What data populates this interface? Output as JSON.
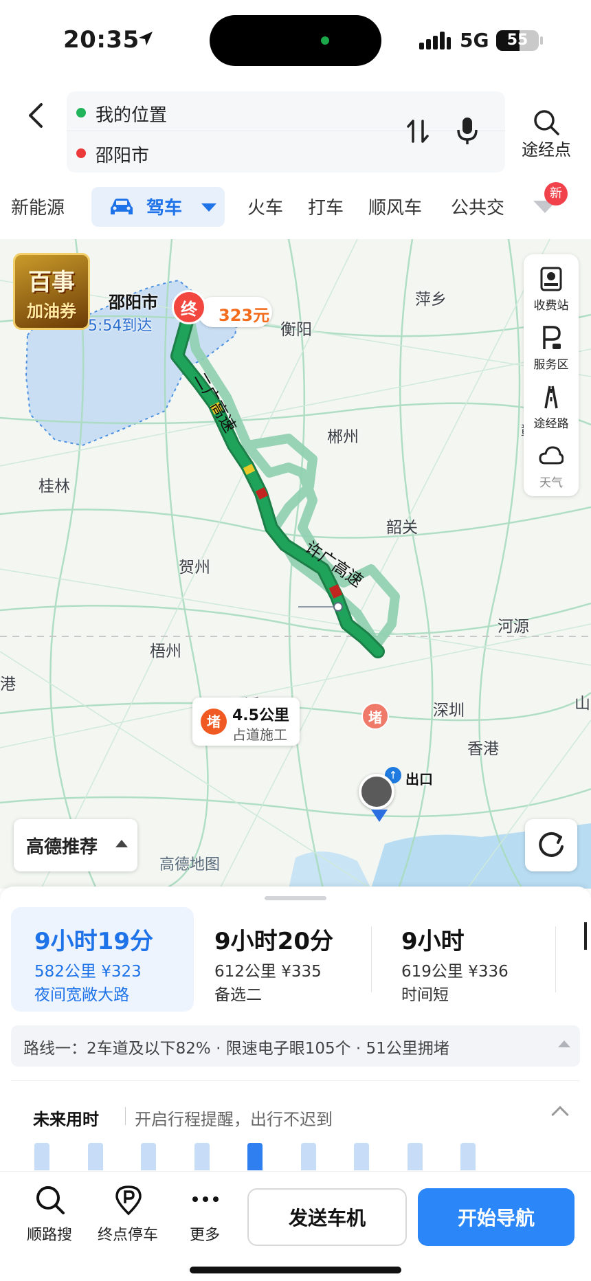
{
  "status_bar": {
    "time": "20:35",
    "network": "5G",
    "battery": "55",
    "battery_level": 0.55
  },
  "search": {
    "origin": "我的位置",
    "destination": "邵阳市",
    "origin_color": "#22b45a",
    "destination_color": "#ec3a3a",
    "waypoint_label": "途经点"
  },
  "modes": {
    "items": [
      "新能源",
      "驾车",
      "火车",
      "打车",
      "顺风车",
      "公共交"
    ],
    "active": "驾车",
    "new_badge": "新"
  },
  "map": {
    "ad_badge": {
      "line1": "百事",
      "line2": "加油券"
    },
    "destination_label": "邵阳市",
    "arrival": "5:54到达",
    "end_pin": "终",
    "toll": "323元",
    "cities": [
      "萍乡",
      "衡阳",
      "郴州",
      "桂林",
      "韶关",
      "贺州",
      "赣州",
      "河源",
      "梧州",
      "云浮",
      "深圳",
      "香港",
      "港",
      "山"
    ],
    "highway_labels": [
      "二广高速",
      "许广高速"
    ],
    "side_tools": [
      "收费站",
      "服务区",
      "途经路",
      "天气"
    ],
    "jam": {
      "icon": "堵",
      "distance": "4.5公里",
      "desc": "占道施工"
    },
    "jam_marker": "堵",
    "exit_label": "出口",
    "recommend_label": "高德推荐",
    "logo_text": "高德地图",
    "route_color": "#1fa35a",
    "alt_route_color": "#8fd0b0"
  },
  "routes": [
    {
      "time": "9小时19分",
      "meta": "582公里 ¥323",
      "tag": "夜间宽敞大路"
    },
    {
      "time": "9小时20分",
      "meta": "612公里 ¥335",
      "tag": "备选二"
    },
    {
      "time": "9小时",
      "meta": "619公里 ¥336",
      "tag": "时间短"
    }
  ],
  "route_info": "路线一：2车道及以下82% · 限速电子眼105个 · 51公里拥堵",
  "future": {
    "title": "未来用时",
    "desc": "开启行程提醒，出行不迟到",
    "highlight_index": 4,
    "bar_levels": [
      0.8,
      0.8,
      0.8,
      0.8,
      0.8,
      0.8,
      0.8,
      0.8,
      0.8
    ]
  },
  "actions": {
    "search_along": "顺路搜",
    "parking": "终点停车",
    "more": "更多",
    "send": "发送车机",
    "navigate": "开始导航"
  }
}
